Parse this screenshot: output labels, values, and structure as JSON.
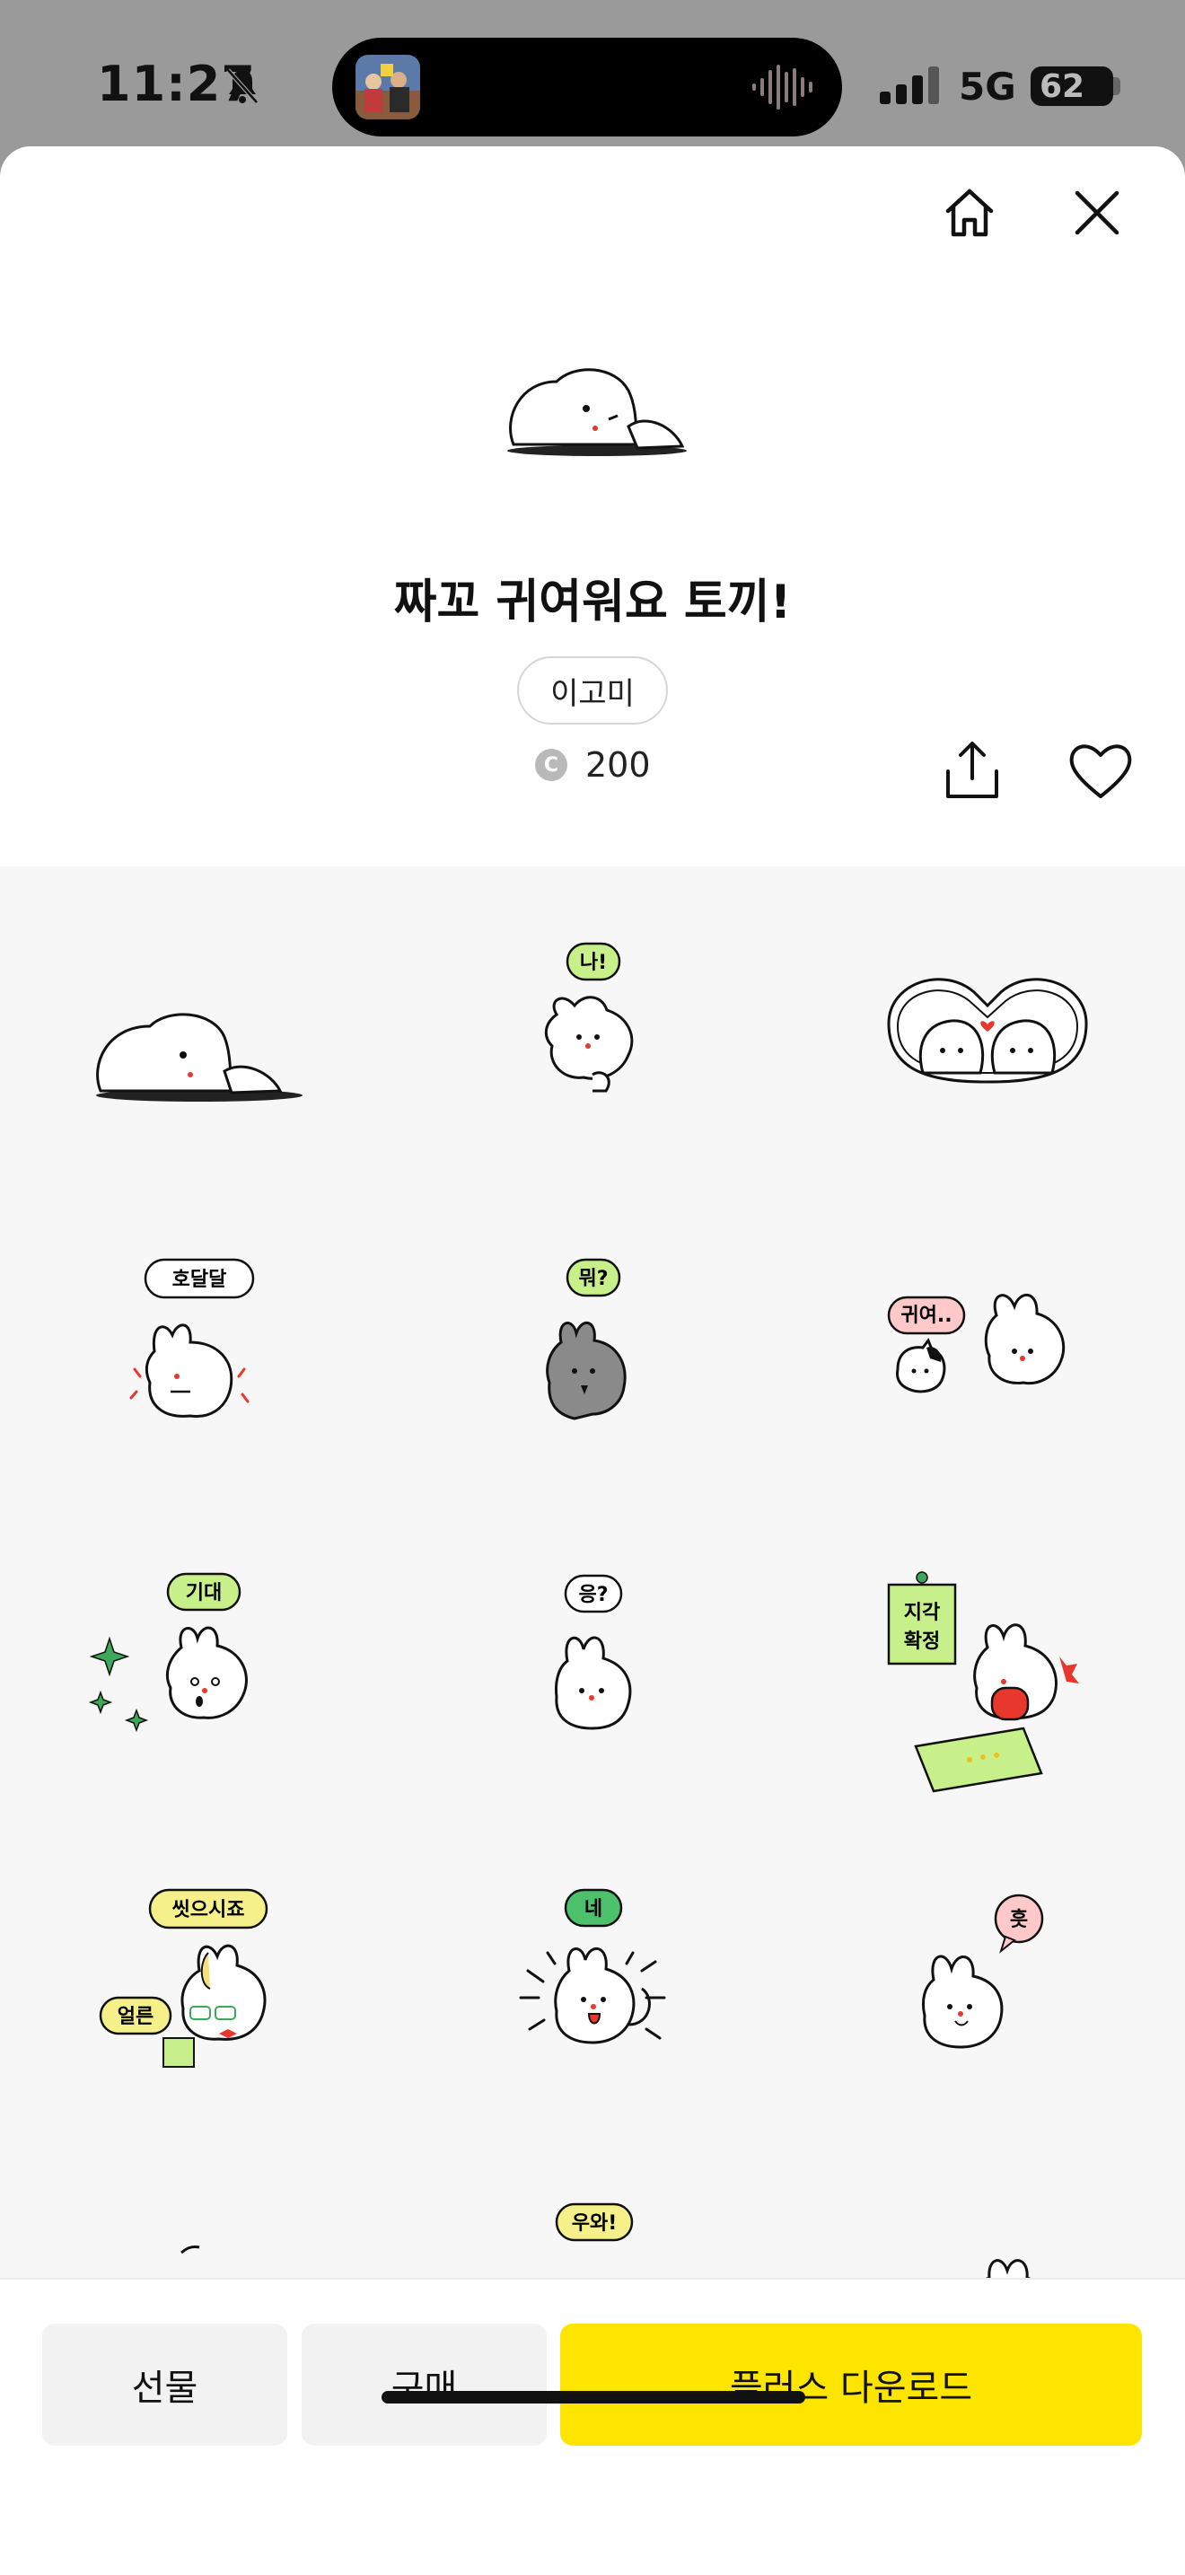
{
  "status_bar": {
    "time": "11:27",
    "network": "5G",
    "battery": "62",
    "icons": [
      "bell-muted-icon",
      "audio-wave-icon",
      "signal-icon",
      "battery-icon"
    ]
  },
  "header": {
    "home_icon": "home-icon",
    "close_icon": "close-icon"
  },
  "pack": {
    "title": "짜꼬 귀여워요 토끼!",
    "author": "이고미",
    "coin_symbol": "C",
    "price": "200",
    "share_icon": "share-icon",
    "like_icon": "heart-icon"
  },
  "stickers": {
    "labels": {
      "s2": "나!",
      "s4": "호달달",
      "s5": "뭐?",
      "s6": "귀여..",
      "s7": "기대",
      "s8": "응?",
      "s9a": "지각",
      "s9b": "확정",
      "s10a": "씻으시죠",
      "s10b": "얼른",
      "s11": "네",
      "s12": "흣",
      "s14": "우와!"
    }
  },
  "actions": {
    "gift": "선물",
    "buy": "구매",
    "plus_download": "플러스 다운로드"
  },
  "colors": {
    "accent_yellow": "#fee500",
    "bubble_green": "#c8f08a",
    "bubble_pink": "#ffc9c9",
    "heart_red": "#e8372c"
  }
}
